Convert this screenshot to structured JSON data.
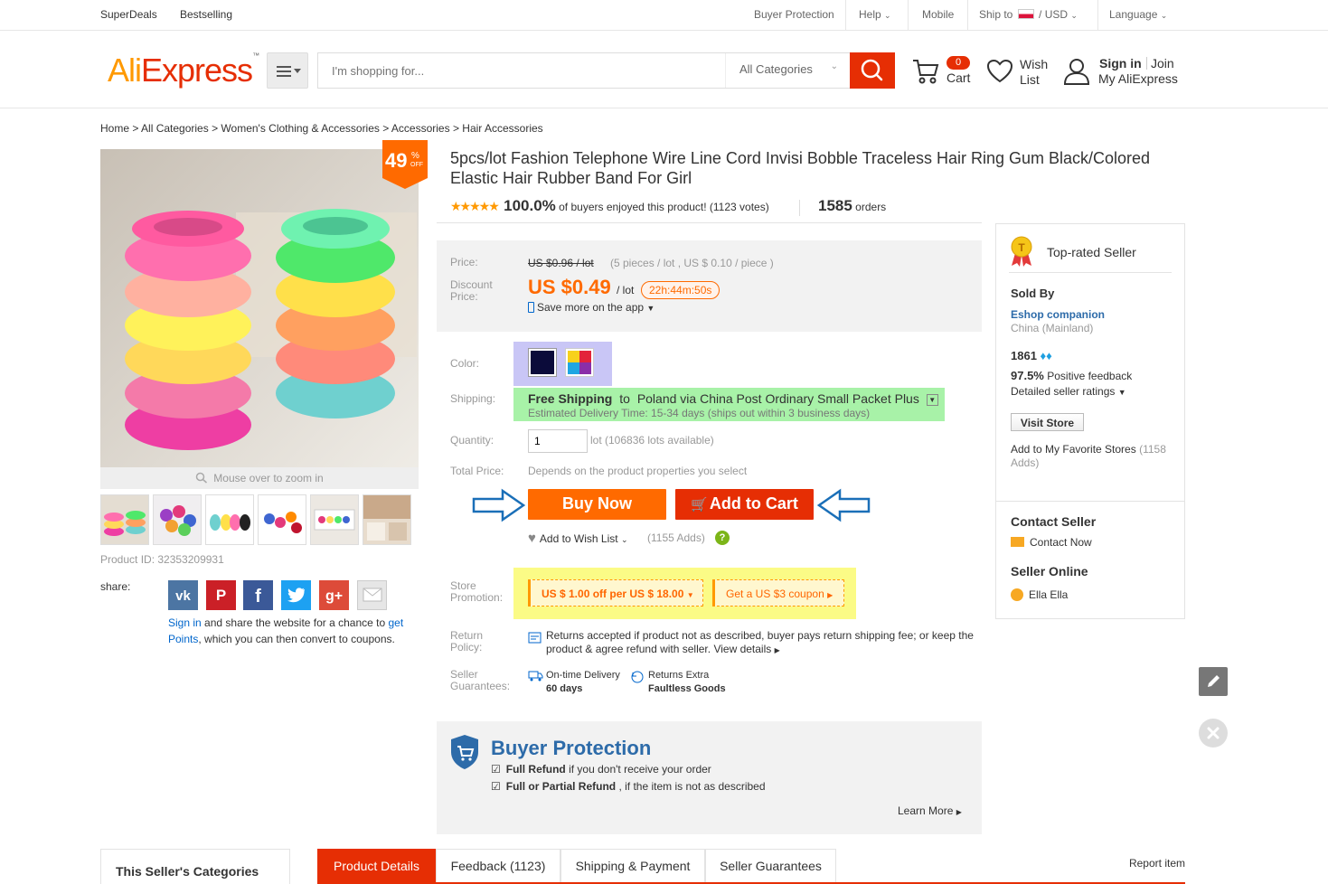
{
  "topbar": {
    "left_links": [
      "SuperDeals",
      "Bestselling"
    ],
    "buyer_protection": "Buyer Protection",
    "help": "Help",
    "mobile": "Mobile",
    "ship_to": "Ship to",
    "currency": "/ USD",
    "language": "Language"
  },
  "header": {
    "logo_ali": "Ali",
    "logo_express": "Express",
    "logo_tm": "™",
    "search_placeholder": "I'm shopping for...",
    "category_select": "All Categories",
    "cart_count": "0",
    "cart_label": "Cart",
    "wish_label_1": "Wish",
    "wish_label_2": "List",
    "sign_in": "Sign in",
    "join": "Join",
    "my_account": "My AliExpress"
  },
  "breadcrumb": [
    "Home",
    "All Categories",
    "Women's Clothing & Accessories",
    "Accessories",
    "Hair Accessories"
  ],
  "gallery": {
    "discount_value": "49",
    "discount_pct": "%",
    "discount_off": "OFF",
    "zoom_hint": "Mouse over to zoom in",
    "product_id": "Product ID: 32353209931"
  },
  "share": {
    "label": "share:",
    "sign_in": "Sign in",
    "text_1": " and share the website for a chance to ",
    "get_points": "get Points",
    "text_2": ", which you can then convert to coupons."
  },
  "product": {
    "title": "5pcs/lot Fashion Telephone Wire Line Cord Invisi Bobble Traceless Hair Ring Gum Black/Colored Elastic Hair Rubber Band For Girl",
    "rating_pct": "100.0%",
    "rating_text": "of buyers enjoyed this product! (1123 votes)",
    "rating_stars": 5,
    "orders_count": "1585",
    "orders_label": "orders"
  },
  "price": {
    "price_label": "Price:",
    "original_price": "US $0.96 / lot",
    "per_piece": "(5 pieces / lot , US $ 0.10 / piece )",
    "discount_label_1": "Discount",
    "discount_label_2": "Price:",
    "discount_price": "US $0.49",
    "per_lot": "/ lot",
    "timer": "22h:44m:50s",
    "app_save": "Save more on the app"
  },
  "options": {
    "color_label": "Color:",
    "shipping_label": "Shipping:",
    "free_shipping": "Free Shipping",
    "ship_to": "to",
    "ship_method": "Poland via China Post Ordinary Small Packet Plus",
    "delivery_time": "Estimated Delivery Time: 15-34 days (ships out within 3 business days)",
    "quantity_label": "Quantity:",
    "quantity_value": "1",
    "lots_available": "lot (106836 lots available)",
    "total_label": "Total Price:",
    "total_value": "Depends on the product properties you select"
  },
  "actions": {
    "buy_now": "Buy Now",
    "add_to_cart": "Add to Cart",
    "add_wish": "Add to Wish List",
    "wish_adds": "(1155 Adds)"
  },
  "promotion": {
    "label_1": "Store",
    "label_2": "Promotion:",
    "coupon_1": "US $ 1.00 off per US $ 18.00",
    "coupon_2": "Get a US $3 coupon"
  },
  "return_policy": {
    "label_1": "Return",
    "label_2": "Policy:",
    "text": "Returns accepted if product not as described, buyer pays return shipping fee; or keep the product & agree refund with seller.",
    "view_details": "View details"
  },
  "guarantees": {
    "label_1": "Seller",
    "label_2": "Guarantees:",
    "g1_title": "On-time Delivery",
    "g1_value": "60 days",
    "g2_title": "Returns Extra",
    "g2_value": "Faultless Goods"
  },
  "buyer_protection": {
    "title": "Buyer Protection",
    "item1_bold": "Full Refund",
    "item1_text": " if you don't receive your order",
    "item2_bold": "Full or Partial Refund",
    "item2_text": " , if the item is not as described",
    "learn_more": "Learn More"
  },
  "seller": {
    "badge": "Top-rated Seller",
    "sold_by": "Sold By",
    "store_name": "Eshop companion",
    "country": "China (Mainland)",
    "score": "1861",
    "feedback_pct": "97.5%",
    "feedback_label": "Positive feedback",
    "detailed": "Detailed seller ratings",
    "visit_store": "Visit Store",
    "favorite": "Add to My Favorite Stores",
    "favorite_count": "(1158 Adds)",
    "contact_title": "Contact Seller",
    "contact_now": "Contact Now",
    "online_title": "Seller Online",
    "online_name": "Ella Ella"
  },
  "bottom": {
    "categories_title": "This Seller's Categories",
    "tabs": [
      "Product Details",
      "Feedback (1123)",
      "Shipping & Payment",
      "Seller Guarantees"
    ],
    "report": "Report item"
  },
  "colors": {
    "accent": "#e62e04",
    "orange": "#ff6a00",
    "link": "#0066cc"
  }
}
